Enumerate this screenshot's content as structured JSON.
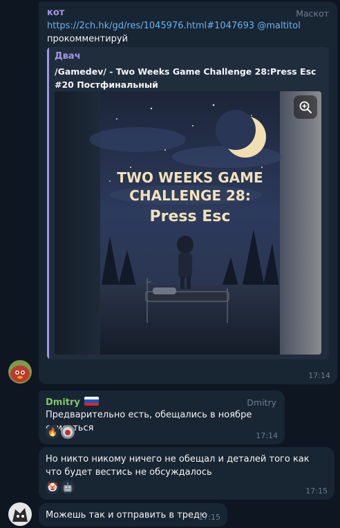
{
  "colors": {
    "background": "#0e1621",
    "bubble": "#182533",
    "preview_bg": "#1f2d3d",
    "accent_purple": "#a695e7",
    "link": "#6ab3f3",
    "green_name": "#7ec86a",
    "meta_text": "#6d7f8f"
  },
  "messages": [
    {
      "sender": "кот",
      "role": "Маскот",
      "link_text": "https://2ch.hk/gd/res/1045976.html#1047693",
      "mention": "@maltitol",
      "text": "прокомментируй",
      "preview": {
        "site": "Двач",
        "title": "/Gamedev/ - Two Weeks Game Challenge 28:Press Esc #20 Постфинальный",
        "image_text_line1": "TWO WEEKS GAME",
        "image_text_line2": "CHALLENGE 28:",
        "image_text_line3": "Press Esc",
        "zoom_icon": "zoom-in-icon"
      },
      "time": "17:14",
      "avatar_icon": "red-creature-avatar"
    },
    {
      "sender": "Dmitry",
      "sender_flag": "russian-flag-icon",
      "role": "Dmitry",
      "text": "Предварительно есть, обещались в ноябре списаться",
      "reactions": [
        "fire-icon",
        "sticker-avatar-icon"
      ],
      "time": "17:14"
    },
    {
      "text": "Но никто никому ничего не обещал и деталей того как что будет вестись не обсуждалось",
      "reactions": [
        "clown-face-icon",
        "robot-face-icon"
      ],
      "time": "17:15"
    },
    {
      "text": "Можешь так и отправить в тредю",
      "time": "17:15",
      "avatar_icon": "dark-creature-avatar"
    }
  ]
}
